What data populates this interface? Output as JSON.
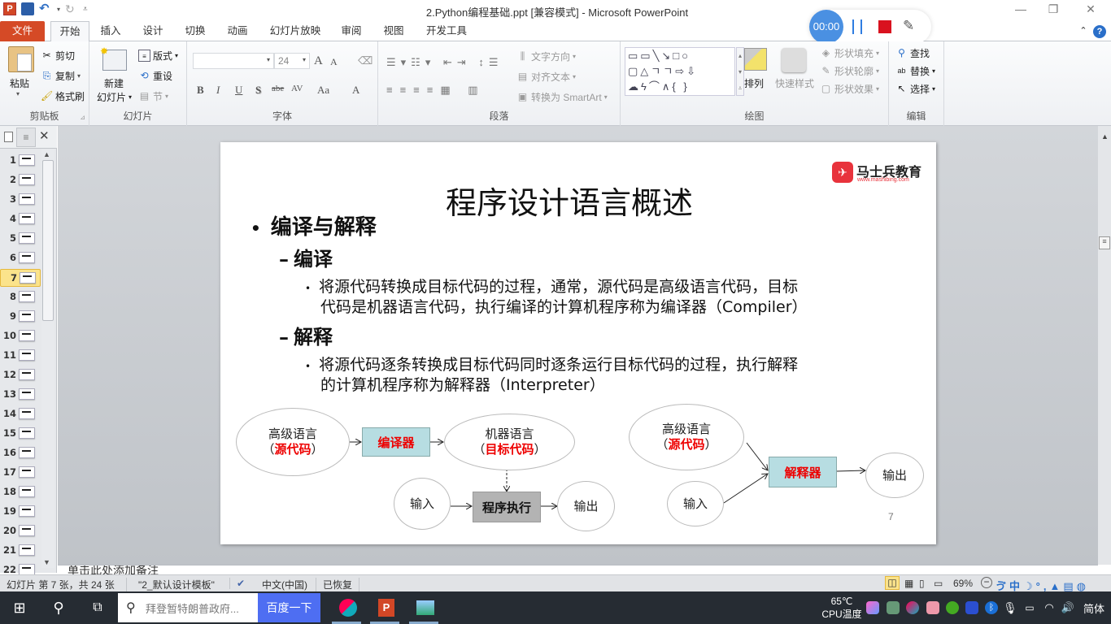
{
  "window": {
    "title": "2.Python编程基础.ppt [兼容模式] - Microsoft PowerPoint",
    "controls": {
      "minimize": "—",
      "restore": "❐",
      "close": "✕"
    }
  },
  "quick_access": {
    "icons": [
      "powerpoint-logo",
      "save",
      "undo",
      "redo",
      "customize"
    ]
  },
  "recorder": {
    "time": "00:00",
    "pause_icon": "pause",
    "stop_icon": "stop",
    "pen_icon": "pen"
  },
  "tabs": [
    {
      "label": "文件",
      "active": false
    },
    {
      "label": "开始",
      "active": true
    },
    {
      "label": "插入"
    },
    {
      "label": "设计"
    },
    {
      "label": "切换"
    },
    {
      "label": "动画"
    },
    {
      "label": "幻灯片放映"
    },
    {
      "label": "审阅"
    },
    {
      "label": "视图"
    },
    {
      "label": "开发工具"
    }
  ],
  "ribbon": {
    "clipboard": {
      "label": "剪贴板",
      "paste": "粘贴",
      "cut": "剪切",
      "copy": "复制",
      "format_painter": "格式刷"
    },
    "slides": {
      "label": "幻灯片",
      "new_slide_1": "新建",
      "new_slide_2": "幻灯片",
      "layout": "版式",
      "reset": "重设",
      "section": "节"
    },
    "font": {
      "label": "字体",
      "font_name": "",
      "font_size": "24",
      "bold": "B",
      "italic": "I",
      "underline": "U",
      "shadow": "S",
      "strike": "abe",
      "spacing": "AV",
      "case": "Aa",
      "color": "A",
      "grow": "A",
      "shrink": "A"
    },
    "paragraph": {
      "label": "段落",
      "text_direction": "文字方向",
      "align_text": "对齐文本",
      "smartart": "转换为 SmartArt"
    },
    "drawing": {
      "label": "绘图",
      "arrange": "排列",
      "quick_styles": "快速样式",
      "shape_fill": "形状填充",
      "shape_outline": "形状轮廓",
      "shape_effects": "形状效果",
      "shapes_gallery": "▭▭╲↘□○\n▢△ㄱㄱ⇨⇩\n☁ϟ⌒∧{ }"
    },
    "editing": {
      "label": "编辑",
      "find": "查找",
      "replace": "替换",
      "select": "选择"
    }
  },
  "slide_panel": {
    "slides": [
      {
        "n": "1"
      },
      {
        "n": "2"
      },
      {
        "n": "3"
      },
      {
        "n": "4"
      },
      {
        "n": "5"
      },
      {
        "n": "6"
      },
      {
        "n": "7",
        "selected": true
      },
      {
        "n": "8"
      },
      {
        "n": "9"
      },
      {
        "n": "10"
      },
      {
        "n": "11"
      },
      {
        "n": "12"
      },
      {
        "n": "13"
      },
      {
        "n": "14"
      },
      {
        "n": "15"
      },
      {
        "n": "16"
      },
      {
        "n": "17"
      },
      {
        "n": "18"
      },
      {
        "n": "19"
      },
      {
        "n": "20"
      },
      {
        "n": "21"
      },
      {
        "n": "22"
      }
    ]
  },
  "slide": {
    "title": "程序设计语言概述",
    "logo_name": "马士兵教育",
    "logo_url_text": "www.mashibing.com",
    "bullet1": "编译与解释",
    "sub1": "编译",
    "sub1_text_line1": "将源代码转换成目标代码的过程，通常，源代码是高级语言代码，目标",
    "sub1_text_line2": "代码是机器语言代码，执行编译的计算机程序称为编译器（Compiler）",
    "sub2": "解释",
    "sub2_text_line1": "将源代码逐条转换成目标代码同时逐条运行目标代码的过程，执行解释",
    "sub2_text_line2": "的计算机程序称为解释器（Interpreter）",
    "page_number": "7",
    "diagram_compile": {
      "source_top": "高级语言",
      "source_paren_open": "（",
      "source_red": "源代码",
      "source_paren_close": "）",
      "compiler": "编译器",
      "target_top": "机器语言",
      "target_paren_open": "（",
      "target_red": "目标代码",
      "target_paren_close": "）",
      "input": "输入",
      "execute": "程序执行",
      "output": "输出"
    },
    "diagram_interpret": {
      "source_top": "高级语言",
      "source_paren_open": "（",
      "source_red": "源代码",
      "source_paren_close": "）",
      "interpreter": "解释器",
      "input": "输入",
      "output": "输出"
    }
  },
  "notes": {
    "placeholder": "单击此处添加备注"
  },
  "statusbar": {
    "slide_info": "幻灯片 第 7 张，共 24 张",
    "theme": "\"2_默认设计模板\"",
    "language": "中文(中国)",
    "recovered": "已恢复",
    "zoom": "69%"
  },
  "taskbar": {
    "search_placeholder": "拜登暂特朗普政府...",
    "search_button": "百度一下",
    "cpu_temp": "65℃",
    "cpu_label": "CPU温度",
    "ime": "简体"
  },
  "colors": {
    "accent_file_tab": "#d54a26",
    "compiler_box": "#b7dde2",
    "execute_box": "#b3b3b3",
    "red_text": "#e00000",
    "recorder_blue": "#4a90e2",
    "stop_red": "#d9121f",
    "baidu_blue": "#4e6ef2"
  }
}
